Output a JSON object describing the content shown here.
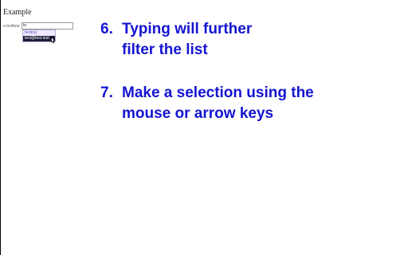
{
  "page": {
    "title": "Example"
  },
  "form": {
    "label": "a textbox:",
    "input_value": "te"
  },
  "suggestions": {
    "items": [
      "testing",
      "test@test.test"
    ],
    "selected_index": 1
  },
  "instructions": {
    "steps": [
      {
        "number": "6.",
        "lines": [
          "Typing will further",
          "filter the list"
        ]
      },
      {
        "number": "7.",
        "lines": [
          "Make a selection using the",
          "mouse or arrow keys"
        ]
      }
    ]
  },
  "colors": {
    "instruction_text": "#1414d2",
    "selected_bg": "#1a1a3a",
    "suggestion_text": "#6a5acd"
  },
  "icons": {
    "cursor": "mouse-pointer-icon"
  }
}
